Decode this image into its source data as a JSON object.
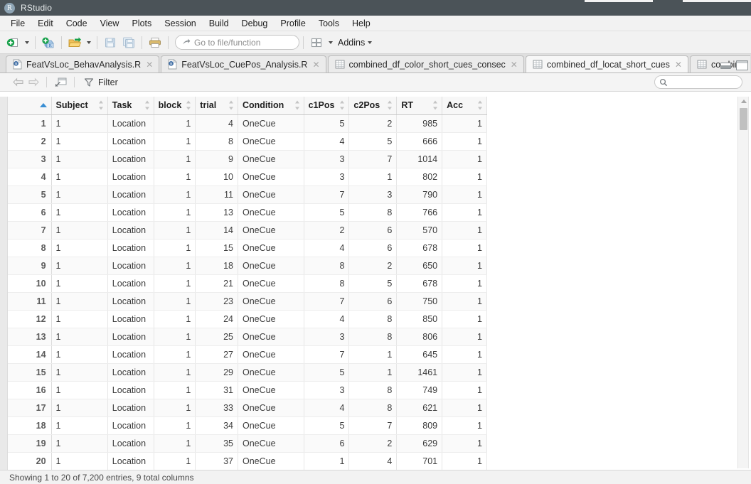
{
  "window": {
    "app_name": "RStudio",
    "logo_letter": "R"
  },
  "menubar": {
    "items": [
      {
        "label": "File"
      },
      {
        "label": "Edit"
      },
      {
        "label": "Code"
      },
      {
        "label": "View"
      },
      {
        "label": "Plots"
      },
      {
        "label": "Session"
      },
      {
        "label": "Build"
      },
      {
        "label": "Debug"
      },
      {
        "label": "Profile"
      },
      {
        "label": "Tools"
      },
      {
        "label": "Help"
      }
    ]
  },
  "toolbar": {
    "new_file_icon": "new-file-icon",
    "new_project_icon": "new-project-icon",
    "open_file_icon": "open-file-icon",
    "save_icon": "save-icon",
    "save_all_icon": "save-all-icon",
    "print_icon": "print-icon",
    "goto_placeholder": "Go to file/function",
    "panes_icon": "workspace-panes-icon",
    "addins_label": "Addins"
  },
  "tabs": [
    {
      "label": "FeatVsLoc_BehavAnalysis.R",
      "icon": "r-script-icon",
      "active": false,
      "closable": true
    },
    {
      "label": "FeatVsLoc_CuePos_Analysis.R",
      "icon": "r-script-icon",
      "active": false,
      "closable": true
    },
    {
      "label": "combined_df_color_short_cues_consec",
      "icon": "data-frame-icon",
      "active": false,
      "closable": true
    },
    {
      "label": "combined_df_locat_short_cues",
      "icon": "data-frame-icon",
      "active": true,
      "closable": true
    },
    {
      "label": "combine",
      "icon": "data-frame-icon",
      "active": false,
      "closable": false
    }
  ],
  "tab_overflow_label": "»",
  "window_buttons": {
    "minimize": "minimize-icon",
    "maximize": "maximize-icon"
  },
  "viewer_toolbar": {
    "back_icon": "back-arrow-icon",
    "forward_icon": "forward-arrow-icon",
    "popout_icon": "show-in-new-window-icon",
    "filter_icon": "filter-funnel-icon",
    "filter_label": "Filter",
    "search_icon": "search-icon",
    "search_value": "",
    "search_placeholder": ""
  },
  "table": {
    "rownum_header": "",
    "sorted_column": "rownum",
    "sort_direction": "asc",
    "columns": [
      {
        "name": "Subject",
        "align": "left"
      },
      {
        "name": "Task",
        "align": "left"
      },
      {
        "name": "block",
        "align": "right"
      },
      {
        "name": "trial",
        "align": "right"
      },
      {
        "name": "Condition",
        "align": "left"
      },
      {
        "name": "c1Pos",
        "align": "right"
      },
      {
        "name": "c2Pos",
        "align": "right"
      },
      {
        "name": "RT",
        "align": "right"
      },
      {
        "name": "Acc",
        "align": "right"
      }
    ],
    "rows": [
      {
        "n": "1",
        "Subject": "1",
        "Task": "Location",
        "block": "1",
        "trial": "4",
        "Condition": "OneCue",
        "c1Pos": "5",
        "c2Pos": "2",
        "RT": "985",
        "Acc": "1"
      },
      {
        "n": "2",
        "Subject": "1",
        "Task": "Location",
        "block": "1",
        "trial": "8",
        "Condition": "OneCue",
        "c1Pos": "4",
        "c2Pos": "5",
        "RT": "666",
        "Acc": "1"
      },
      {
        "n": "3",
        "Subject": "1",
        "Task": "Location",
        "block": "1",
        "trial": "9",
        "Condition": "OneCue",
        "c1Pos": "3",
        "c2Pos": "7",
        "RT": "1014",
        "Acc": "1"
      },
      {
        "n": "4",
        "Subject": "1",
        "Task": "Location",
        "block": "1",
        "trial": "10",
        "Condition": "OneCue",
        "c1Pos": "3",
        "c2Pos": "1",
        "RT": "802",
        "Acc": "1"
      },
      {
        "n": "5",
        "Subject": "1",
        "Task": "Location",
        "block": "1",
        "trial": "11",
        "Condition": "OneCue",
        "c1Pos": "7",
        "c2Pos": "3",
        "RT": "790",
        "Acc": "1"
      },
      {
        "n": "6",
        "Subject": "1",
        "Task": "Location",
        "block": "1",
        "trial": "13",
        "Condition": "OneCue",
        "c1Pos": "5",
        "c2Pos": "8",
        "RT": "766",
        "Acc": "1"
      },
      {
        "n": "7",
        "Subject": "1",
        "Task": "Location",
        "block": "1",
        "trial": "14",
        "Condition": "OneCue",
        "c1Pos": "2",
        "c2Pos": "6",
        "RT": "570",
        "Acc": "1"
      },
      {
        "n": "8",
        "Subject": "1",
        "Task": "Location",
        "block": "1",
        "trial": "15",
        "Condition": "OneCue",
        "c1Pos": "4",
        "c2Pos": "6",
        "RT": "678",
        "Acc": "1"
      },
      {
        "n": "9",
        "Subject": "1",
        "Task": "Location",
        "block": "1",
        "trial": "18",
        "Condition": "OneCue",
        "c1Pos": "8",
        "c2Pos": "2",
        "RT": "650",
        "Acc": "1"
      },
      {
        "n": "10",
        "Subject": "1",
        "Task": "Location",
        "block": "1",
        "trial": "21",
        "Condition": "OneCue",
        "c1Pos": "8",
        "c2Pos": "5",
        "RT": "678",
        "Acc": "1"
      },
      {
        "n": "11",
        "Subject": "1",
        "Task": "Location",
        "block": "1",
        "trial": "23",
        "Condition": "OneCue",
        "c1Pos": "7",
        "c2Pos": "6",
        "RT": "750",
        "Acc": "1"
      },
      {
        "n": "12",
        "Subject": "1",
        "Task": "Location",
        "block": "1",
        "trial": "24",
        "Condition": "OneCue",
        "c1Pos": "4",
        "c2Pos": "8",
        "RT": "850",
        "Acc": "1"
      },
      {
        "n": "13",
        "Subject": "1",
        "Task": "Location",
        "block": "1",
        "trial": "25",
        "Condition": "OneCue",
        "c1Pos": "3",
        "c2Pos": "8",
        "RT": "806",
        "Acc": "1"
      },
      {
        "n": "14",
        "Subject": "1",
        "Task": "Location",
        "block": "1",
        "trial": "27",
        "Condition": "OneCue",
        "c1Pos": "7",
        "c2Pos": "1",
        "RT": "645",
        "Acc": "1"
      },
      {
        "n": "15",
        "Subject": "1",
        "Task": "Location",
        "block": "1",
        "trial": "29",
        "Condition": "OneCue",
        "c1Pos": "5",
        "c2Pos": "1",
        "RT": "1461",
        "Acc": "1"
      },
      {
        "n": "16",
        "Subject": "1",
        "Task": "Location",
        "block": "1",
        "trial": "31",
        "Condition": "OneCue",
        "c1Pos": "3",
        "c2Pos": "8",
        "RT": "749",
        "Acc": "1"
      },
      {
        "n": "17",
        "Subject": "1",
        "Task": "Location",
        "block": "1",
        "trial": "33",
        "Condition": "OneCue",
        "c1Pos": "4",
        "c2Pos": "8",
        "RT": "621",
        "Acc": "1"
      },
      {
        "n": "18",
        "Subject": "1",
        "Task": "Location",
        "block": "1",
        "trial": "34",
        "Condition": "OneCue",
        "c1Pos": "5",
        "c2Pos": "7",
        "RT": "809",
        "Acc": "1"
      },
      {
        "n": "19",
        "Subject": "1",
        "Task": "Location",
        "block": "1",
        "trial": "35",
        "Condition": "OneCue",
        "c1Pos": "6",
        "c2Pos": "2",
        "RT": "629",
        "Acc": "1"
      },
      {
        "n": "20",
        "Subject": "1",
        "Task": "Location",
        "block": "1",
        "trial": "37",
        "Condition": "OneCue",
        "c1Pos": "1",
        "c2Pos": "4",
        "RT": "701",
        "Acc": "1"
      }
    ]
  },
  "statusbar": {
    "text": "Showing 1 to 20 of 7,200 entries, 9 total columns"
  },
  "colors": {
    "titlebar_bg": "#4b5358",
    "chrome_bg": "#f2f2f2",
    "tabbar_bg": "#dfdfdf",
    "sort_accent": "#3a8fd4",
    "row_alt": "#fafafa"
  }
}
